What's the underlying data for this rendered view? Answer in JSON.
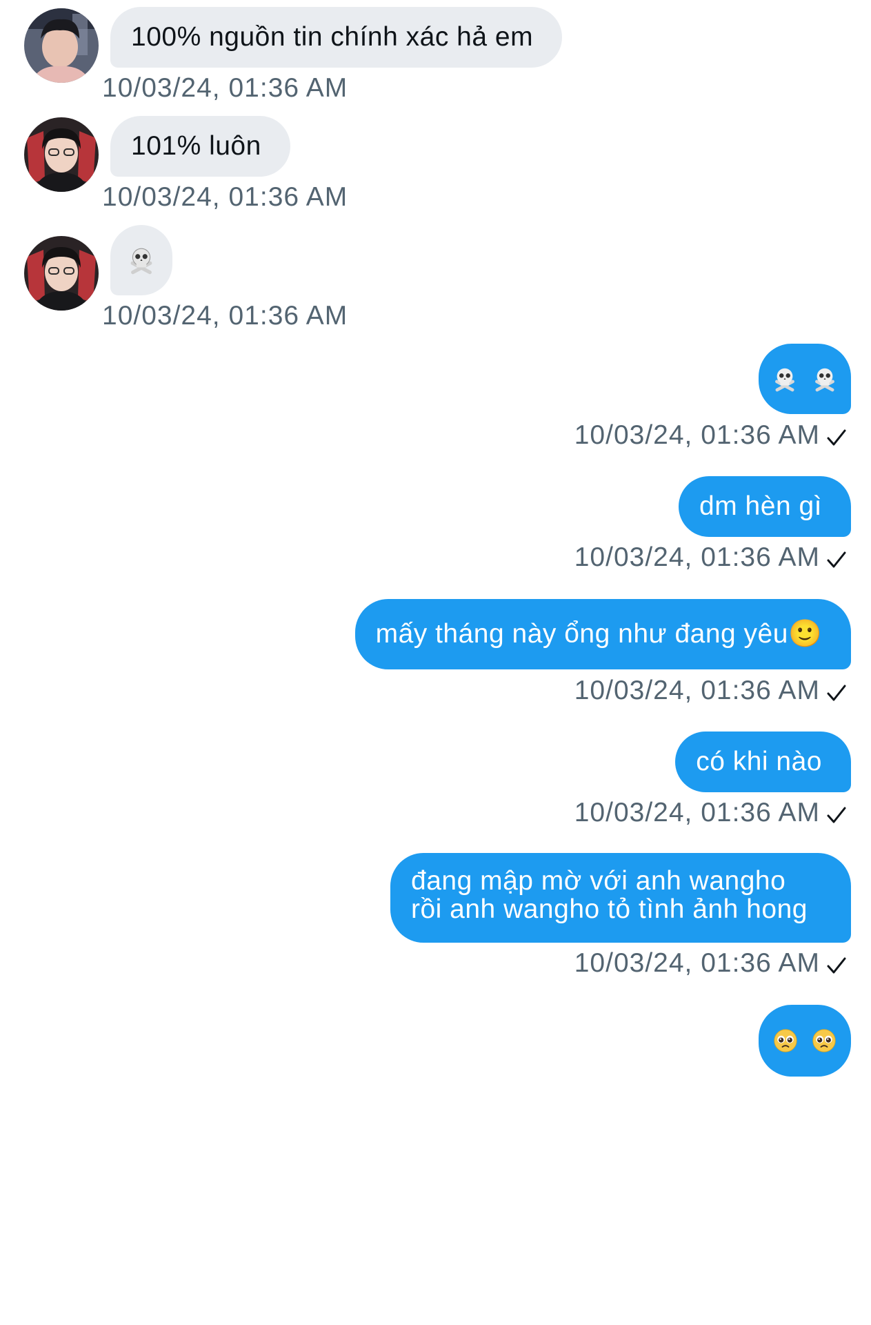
{
  "messages": [
    {
      "direction": "incoming",
      "text": "100% nguồn tin chính xác hả em",
      "timestamp": "10/03/24, 01:36 AM"
    },
    {
      "direction": "incoming",
      "text": "101% luôn",
      "timestamp": "10/03/24, 01:36 AM"
    },
    {
      "direction": "incoming",
      "emoji": [
        "skull-and-crossbones"
      ],
      "timestamp": "10/03/24, 01:36 AM"
    },
    {
      "direction": "outgoing",
      "emoji": [
        "skull-and-crossbones",
        "skull-and-crossbones"
      ],
      "timestamp": "10/03/24, 01:36 AM",
      "status": "sent"
    },
    {
      "direction": "outgoing",
      "text": "dm hèn gì",
      "timestamp": "10/03/24, 01:36 AM",
      "status": "sent"
    },
    {
      "direction": "outgoing",
      "text": "mấy tháng này ổng như đang yêu🙂",
      "timestamp": "10/03/24, 01:36 AM",
      "status": "sent"
    },
    {
      "direction": "outgoing",
      "text": "có khi nào",
      "timestamp": "10/03/24, 01:36 AM",
      "status": "sent"
    },
    {
      "direction": "outgoing",
      "text": "đang mập mờ với anh wangho rồi anh wangho tỏ tình ảnh hong",
      "timestamp": "10/03/24, 01:36 AM",
      "status": "sent"
    },
    {
      "direction": "outgoing",
      "emoji": [
        "pleading-face",
        "pleading-face"
      ]
    }
  ],
  "colors": {
    "incoming_bubble": "#e9ecf0",
    "outgoing_bubble": "#1d9bf0",
    "timestamp": "#536471"
  },
  "icons": {
    "sent_status": "checkmark-icon",
    "avatar": "avatar"
  }
}
